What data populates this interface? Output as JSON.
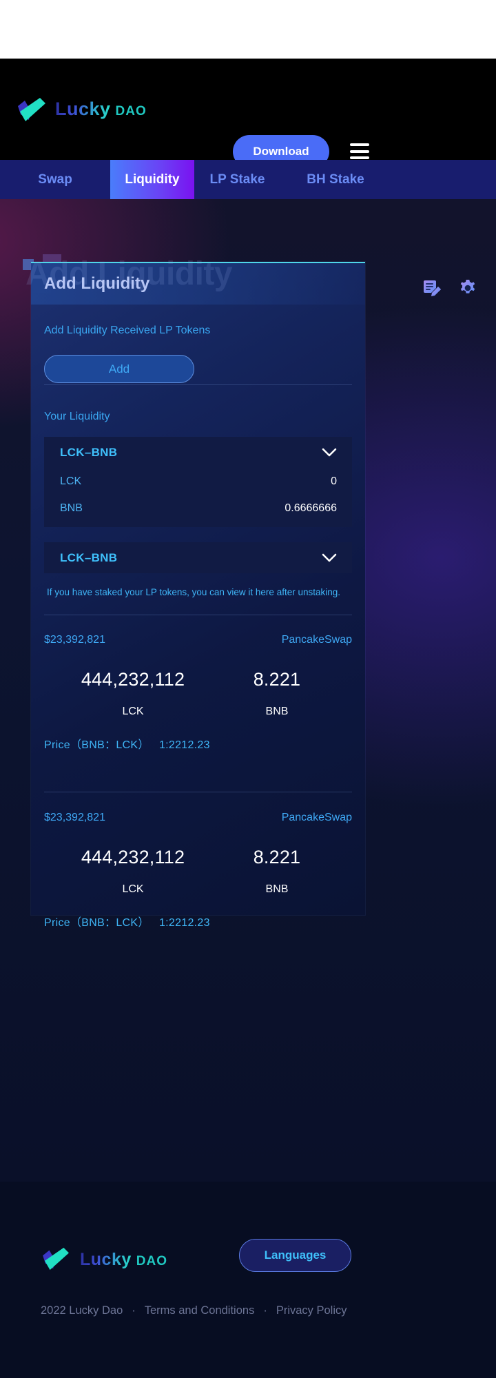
{
  "brand": {
    "name_primary": "Lucky",
    "name_secondary": "DAO",
    "logo_icon": "check-mark-logo-icon"
  },
  "header": {
    "download_label": "Download",
    "menu_icon": "hamburger-menu-icon"
  },
  "nav": {
    "tabs": [
      {
        "label": "Swap",
        "active": false
      },
      {
        "label": "Liquidity",
        "active": true
      },
      {
        "label": "LP Stake",
        "active": false
      },
      {
        "label": "BH Stake",
        "active": false
      }
    ]
  },
  "card": {
    "title": "Add Liquidity",
    "ghost_title": "Add Liquidity",
    "subtitle": "Add Liquidity Received LP Tokens",
    "add_button_label": "Add",
    "note_icon": "note-edit-icon",
    "settings_icon": "gear-icon",
    "your_liquidity_label": "Your Liquidity",
    "pairs": [
      {
        "name": "LCK–BNB",
        "chevron_icon": "chevron-down-icon",
        "expanded": true,
        "rows": [
          {
            "token": "LCK",
            "amount": "0"
          },
          {
            "token": "BNB",
            "amount": "0.6666666"
          }
        ]
      },
      {
        "name": "LCK–BNB",
        "chevron_icon": "chevron-down-icon",
        "expanded": false,
        "rows": []
      }
    ],
    "hint": "If you have staked your LP tokens, you can view it here after unstaking.",
    "pools": [
      {
        "usd_value": "$23,392,821",
        "exchange": "PancakeSwap",
        "token_a_amount": "444,232,112",
        "token_a_symbol": "LCK",
        "token_b_amount": "8.221",
        "token_b_symbol": "BNB",
        "price_label": "Price（BNB：LCK）",
        "price_value": "1:2212.23"
      },
      {
        "usd_value": "$23,392,821",
        "exchange": "PancakeSwap",
        "token_a_amount": "444,232,112",
        "token_a_symbol": "LCK",
        "token_b_amount": "8.221",
        "token_b_symbol": "BNB",
        "price_label": "Price（BNB：LCK）",
        "price_value": "1:2212.23"
      }
    ]
  },
  "footer": {
    "languages_label": "Languages",
    "copyright": "2022 Lucky Dao",
    "separator": "·",
    "terms_label": "Terms and Conditions",
    "privacy_label": "Privacy Policy"
  },
  "colors": {
    "accent_blue": "#4a6cf7",
    "cyan": "#3fc0fb",
    "nav_bg": "#181d6e",
    "active_tab_gradient_from": "#4a7dfb",
    "active_tab_gradient_to": "#7a12f0",
    "card_bg": "#0d1842",
    "footer_bg": "#070d22"
  }
}
